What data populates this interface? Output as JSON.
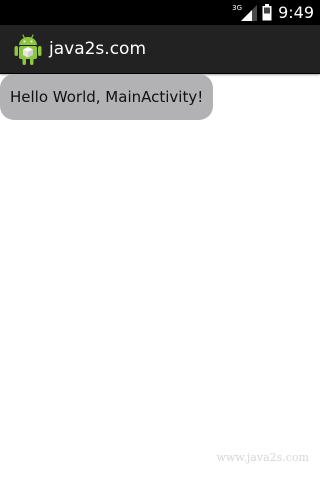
{
  "status_bar": {
    "network_type": "3G",
    "time": "9:49",
    "signal_icon": "signal-icon",
    "battery_icon": "battery-icon"
  },
  "action_bar": {
    "icon": "android-robot-icon",
    "title": "java2s.com"
  },
  "content": {
    "text": "Hello World, MainActivity!"
  },
  "watermark": "www.java2s.com",
  "colors": {
    "status_bar_bg": "#000000",
    "action_bar_bg": "#222222",
    "text_background": "#b2b1b3",
    "android_green": "#8dc63f"
  }
}
